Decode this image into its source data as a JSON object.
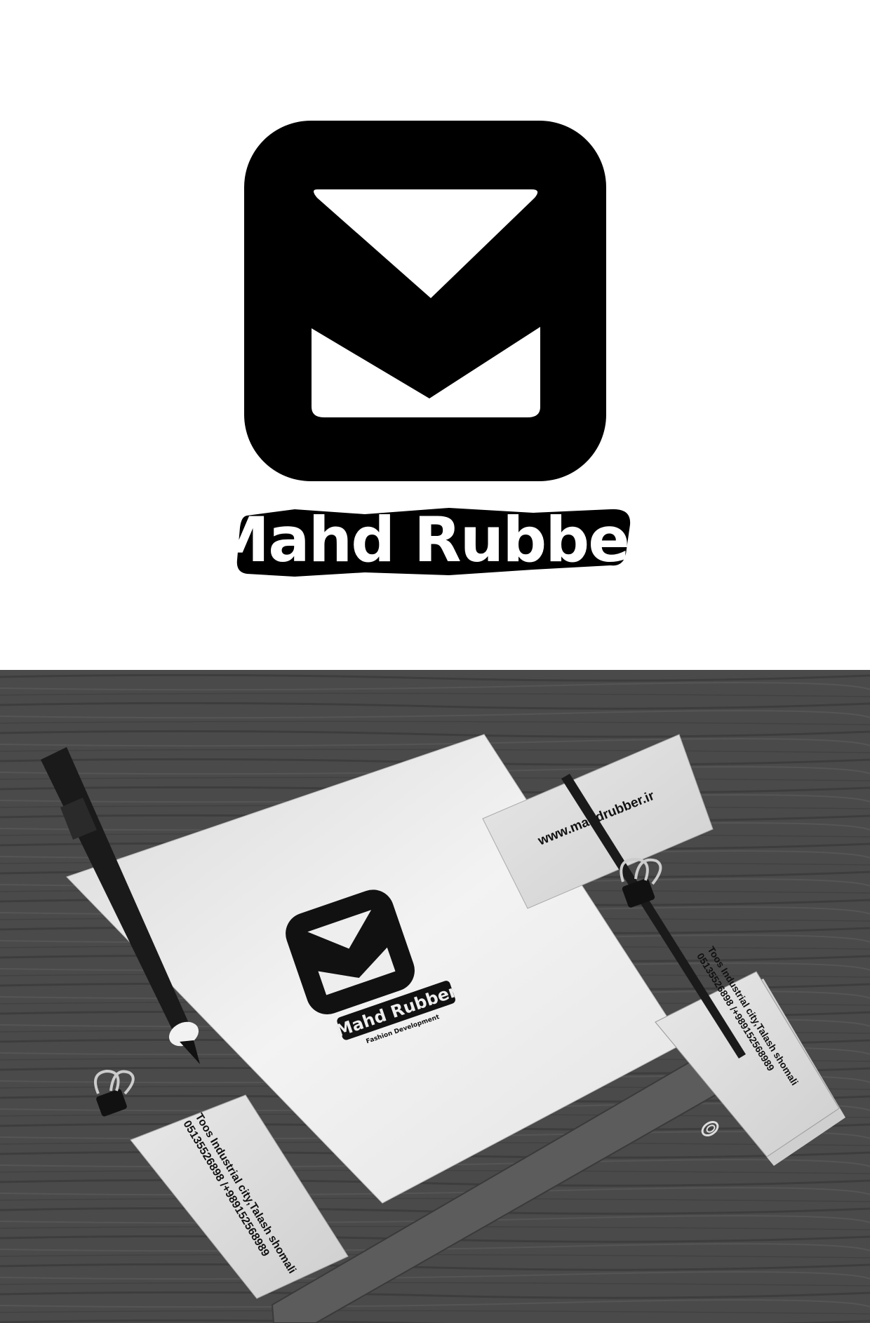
{
  "brand": {
    "name": "Mahd Rubber",
    "tagline": "Fashion Development"
  },
  "stationery": {
    "website": "www.mahdrubber.ir",
    "address": "Toos Industrial city,Talash shomali",
    "phones": "05135526898 /+989152568989"
  },
  "colors": {
    "logo": "#000000",
    "background": "#ffffff",
    "desk": "#4a4a4a",
    "paper": "#eeeeee"
  }
}
